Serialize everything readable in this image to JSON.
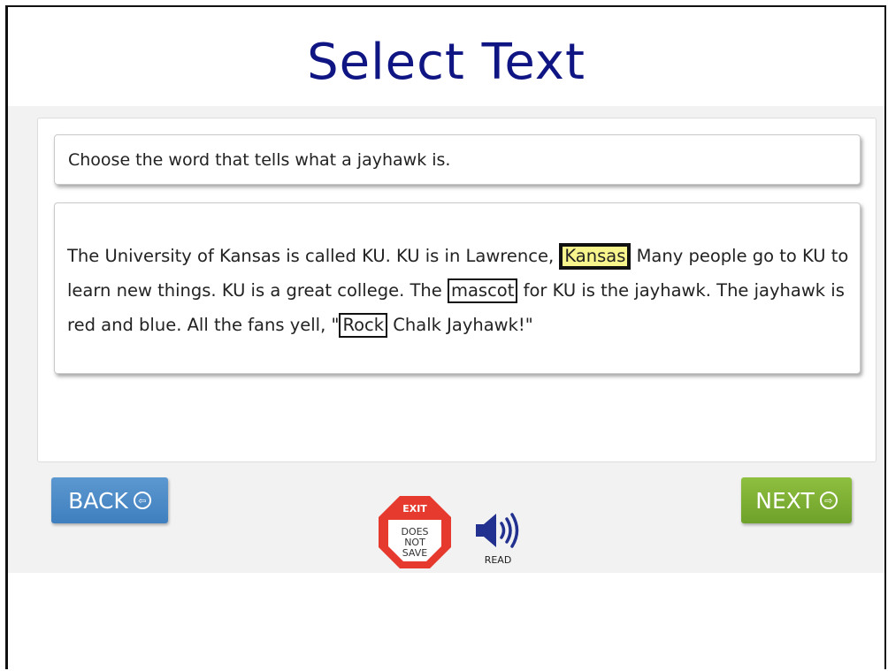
{
  "title": "Select Text",
  "prompt": "Choose the word that tells what a jayhawk is.",
  "passage": {
    "s1": "The University of Kansas is called KU. KU is in Lawrence,",
    "choice1": "Kansas",
    "s2": "Many people go to KU to learn new things. KU is a great college. The",
    "choice2": "mascot",
    "s3": "for KU is the jayhawk. The jayhawk is red and blue. All the fans yell, \"",
    "choice3": "Rock",
    "s4": "Chalk Jayhawk!\""
  },
  "selected_choice": "Kansas",
  "buttons": {
    "back": "BACK",
    "next": "NEXT"
  },
  "exit": {
    "title": "EXIT",
    "line1": "DOES",
    "line2": "NOT",
    "line3": "SAVE"
  },
  "read": {
    "label": "READ"
  },
  "colors": {
    "title": "#0f1582",
    "back_button": "#4a88c6",
    "next_button": "#7aae33",
    "selection_highlight": "#f8f58c",
    "exit_sign": "#e63a2e",
    "speaker": "#22308f"
  }
}
